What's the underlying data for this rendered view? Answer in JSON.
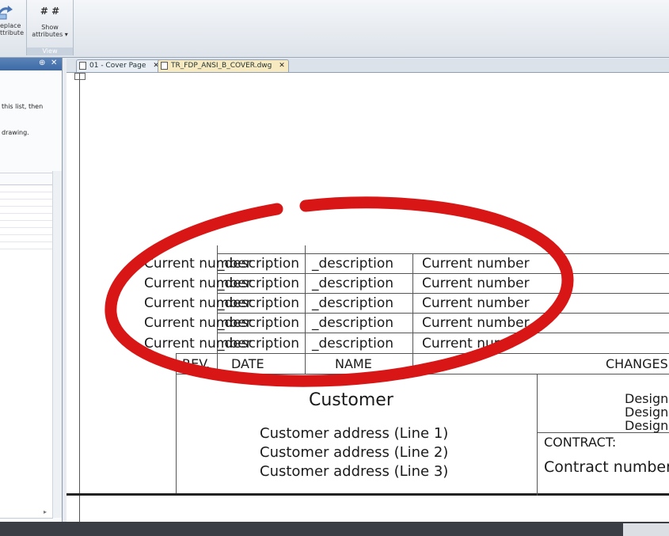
{
  "ribbon": {
    "replace_label_line1": "eplace",
    "replace_label_line2": "ttribute",
    "show_icon": "# #",
    "show_label_line1": "Show",
    "show_label_line2": "attributes ▾",
    "view_caption": "View"
  },
  "left_panel": {
    "pin": "⊕",
    "close": "✕",
    "text_line1": "this list, then",
    "text_line2": "drawing.",
    "scroll_arrow": "▸"
  },
  "tabs": [
    {
      "label": "01 - Cover Page",
      "close": "✕"
    },
    {
      "label": "TR_FDP_ANSI_B_COVER.dwg",
      "close": "✕"
    }
  ],
  "revisions": {
    "rows": [
      {
        "rev": "Current number",
        "date": "_description",
        "name": "_description",
        "changes": "Current number"
      },
      {
        "rev": "Current number",
        "date": "_description",
        "name": "_description",
        "changes": "Current number"
      },
      {
        "rev": "Current number",
        "date": "_description",
        "name": "_description",
        "changes": "Current number"
      },
      {
        "rev": "Current number",
        "date": "_description",
        "name": "_description",
        "changes": "Current number"
      },
      {
        "rev": "Current number",
        "date": "_description",
        "name": "_description",
        "changes": "Current numb"
      }
    ],
    "headers": {
      "rev": "REV.",
      "date": "DATE",
      "name": "NAME",
      "changes": "CHANGES"
    }
  },
  "title_block": {
    "customer": "Customer",
    "address_line1": "Customer address (Line 1)",
    "address_line2": "Customer address (Line 2)",
    "address_line3": "Customer address (Line 3)",
    "design1": "Design",
    "design2": "Design",
    "design3": "Design",
    "contract_label": "CONTRACT:",
    "contract_number": "Contract number"
  },
  "colors": {
    "annotation_red": "#d81616",
    "ribbon_caption": "#c8d2de"
  }
}
